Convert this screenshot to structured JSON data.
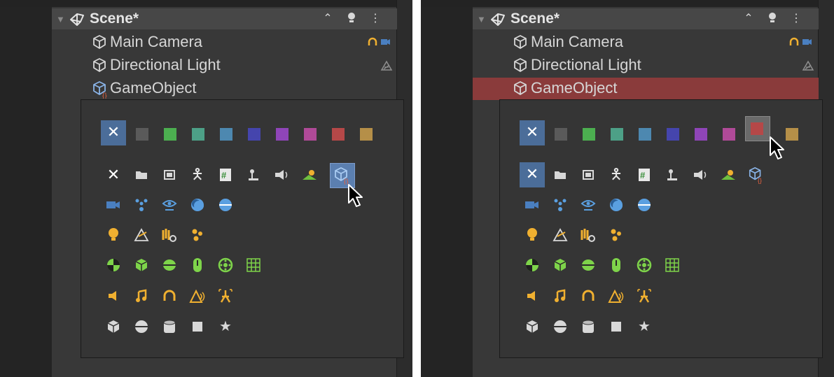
{
  "scene": {
    "title": "Scene*"
  },
  "hierarchy": {
    "items": [
      "Main Camera",
      "Directional Light",
      "GameObject"
    ]
  },
  "colors": {
    "label_swatches": [
      "#5a5a5a",
      "#4caf50",
      "#4da087",
      "#4d88b0",
      "#4545ad",
      "#8f45b8",
      "#b04a98",
      "#b54848",
      "#b58f48"
    ],
    "selected_row": "#8a3b3b",
    "selection_blue": "#4b6d99"
  },
  "icons": {
    "row1": [
      "close-icon",
      "folder-icon",
      "frame-icon",
      "humanoid-icon",
      "script-icon",
      "joystick-icon",
      "speaker-icon",
      "terrain-icon",
      "gameobject-script-icon"
    ],
    "row2": [
      "camera-icon",
      "particles-icon",
      "eye-icon",
      "sphere-light-icon",
      "hemisphere-icon"
    ],
    "row3": [
      "light-bulb-icon",
      "directional-light-icon",
      "light-probe-icon",
      "reflection-probe-icon"
    ],
    "row4": [
      "box-collider-icon",
      "cube-collider-icon",
      "capsule-collider-icon",
      "mesh-collider-icon",
      "wheel-icon",
      "grid-icon"
    ],
    "row5": [
      "audio-source-icon",
      "music-icon",
      "headphones-icon",
      "reverb-icon",
      "chorus-icon"
    ],
    "row6": [
      "cube-icon",
      "sphere-icon",
      "cylinder-icon",
      "quad-icon",
      "star-icon"
    ]
  }
}
